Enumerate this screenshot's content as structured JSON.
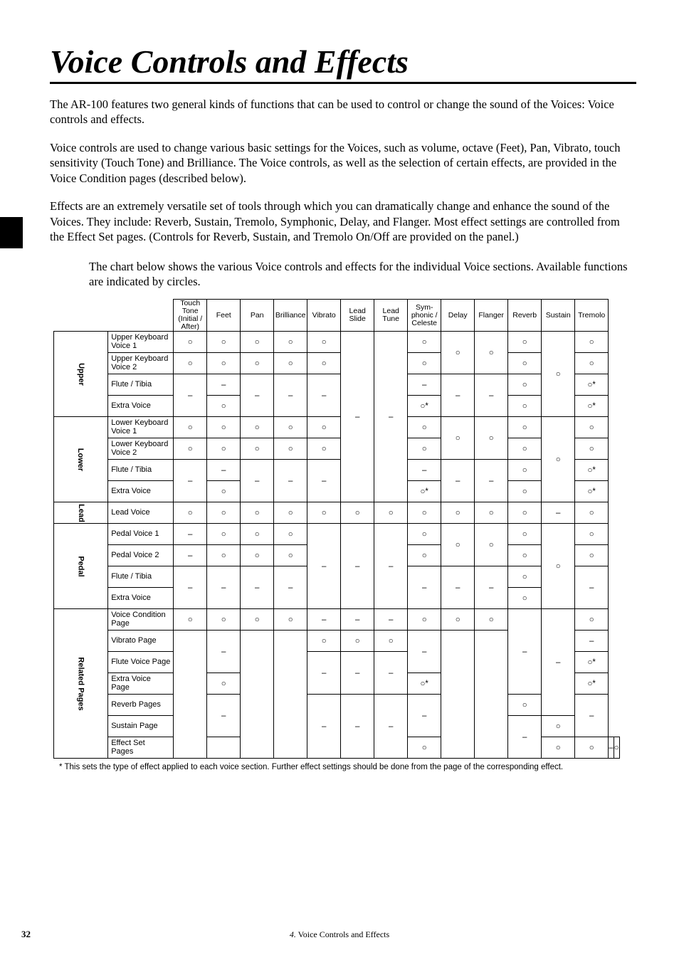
{
  "title": "Voice Controls and Effects",
  "para1": "The AR-100 features two general kinds of functions that can be used to control or change the sound of the Voices: Voice controls and effects.",
  "para2": "Voice controls are used to change various basic settings for the Voices, such as volume, octave (Feet), Pan, Vibrato, touch sensitivity (Touch Tone) and Brilliance.  The Voice controls, as well as the selection of certain effects, are provided in the Voice Condition pages (described below).",
  "para3": "Effects are an extremely versatile set of tools through which you can dramatically change and enhance the sound of the Voices.  They include: Reverb, Sustain, Tremolo, Symphonic, Delay, and Flanger.  Most effect settings are controlled from the Effect Set pages.  (Controls for Reverb, Sustain, and Tremolo On/Off are provided on the panel.)",
  "chart_intro": "The chart below shows the various Voice controls and effects for the individual Voice sections. Available functions are indicated by circles.",
  "columns": [
    "Touch\nTone\n(Initial /\nAfter)",
    "Feet",
    "Pan",
    "Brilliance",
    "Vibrato",
    "Lead\nSlide",
    "Lead\nTune",
    "Sym-\nphonic /\nCeleste",
    "Delay",
    "Flanger",
    "Reverb",
    "Sustain",
    "Tremolo"
  ],
  "groups": [
    {
      "name": "Upper",
      "rows": [
        "Upper Keyboard\nVoice 1",
        "Upper Keyboard\nVoice 2",
        "Flute / Tibia",
        "Extra Voice"
      ]
    },
    {
      "name": "Lower",
      "rows": [
        "Lower Keyboard\nVoice 1",
        "Lower Keyboard\nVoice 2",
        "Flute / Tibia",
        "Extra Voice"
      ]
    },
    {
      "name": "Lead",
      "rows": [
        "Lead Voice"
      ]
    },
    {
      "name": "Pedal",
      "rows": [
        "Pedal Voice 1",
        "Pedal Voice 2",
        "Flute / Tibia",
        "Extra Voice"
      ]
    },
    {
      "name": "Related Pages",
      "rows": [
        "Voice Condition\nPage",
        "Vibrato Page",
        "Flute Voice Page",
        "Extra Voice\nPage",
        "Reverb Pages",
        "Sustain Page",
        "Effect Set\nPages"
      ]
    }
  ],
  "footnote": "* This sets the type of effect applied to each voice section. Further effect settings should be done from the page of the corresponding effect.",
  "page_number": "32",
  "footer_num": "4.",
  "footer_text": "Voice Controls and Effects"
}
